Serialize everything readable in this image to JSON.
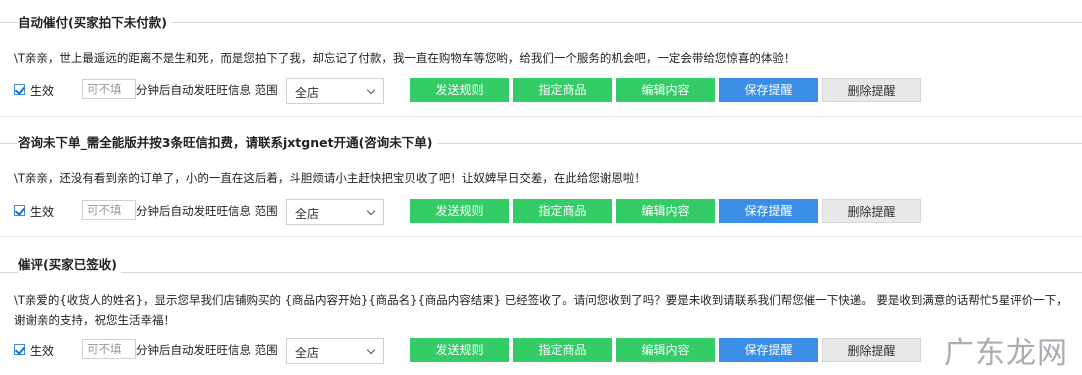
{
  "common": {
    "enable_label": "生效",
    "minutes_placeholder": "可不填",
    "after_text": "分钟后自动发旺旺信息 范围",
    "scope_value": "全店",
    "btn_rules": "发送规则",
    "btn_product": "指定商品",
    "btn_edit": "编辑内容",
    "btn_save": "保存提醒",
    "btn_delete": "删除提醒"
  },
  "sections": [
    {
      "title": "自动催付(买家拍下未付款)",
      "message": "\\T亲亲，世上最遥远的距离不是生和死，而是您拍下了我，却忘记了付款，我一直在购物车等您哟，给我们一个服务的机会吧，一定会带给您惊喜的体验！"
    },
    {
      "title": "咨询未下单_需全能版并按3条旺信扣费，请联系jxtgnet开通(咨询未下单)",
      "message": "\\T亲亲，还没有看到亲的订单了，小的一直在这后着，斗胆烦请小主赶快把宝贝收了吧！让奴婢早日交差，在此给您谢恩啦！"
    },
    {
      "title": "催评(买家已签收)",
      "message": "\\T亲爱的{收货人的姓名}，显示您早我们店铺购买的 {商品内容开始}{商品名}{商品内容结束} 已经签收了。请问您收到了吗？要是未收到请联系我们帮您催一下快递。 要是收到满意的话帮忙5星评价一下，谢谢亲的支持，祝您生活幸福！"
    }
  ],
  "watermark": "广东龙网",
  "colors": {
    "green": "#33cc66",
    "blue": "#3a8ee6",
    "grey": "#e8e8e8"
  }
}
